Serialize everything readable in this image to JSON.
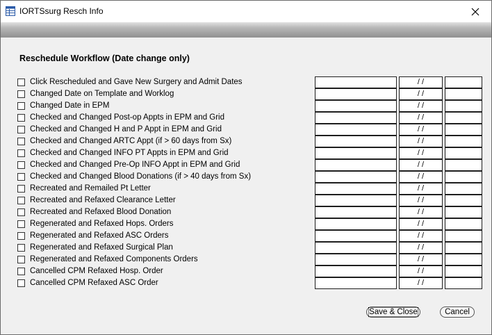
{
  "window": {
    "title": "IORTSsurg Resch Info"
  },
  "section_title": "Reschedule Workflow (Date change only)",
  "date_placeholder": " / /",
  "rows": [
    {
      "label": "Click Rescheduled and Gave New Surgery and Admit Dates",
      "date": " / /"
    },
    {
      "label": "Changed Date on Template and Worklog",
      "date": " / /"
    },
    {
      "label": "Changed Date in EPM",
      "date": " / /"
    },
    {
      "label": "Checked and Changed Post-op Appts in EPM and Grid",
      "date": " / /"
    },
    {
      "label": "Checked and Changed H and P Appt in EPM and Grid",
      "date": " / /"
    },
    {
      "label": "Checked and Changed ARTC Appt (if > 60 days from Sx)",
      "date": " / /"
    },
    {
      "label": "Checked and Changed INFO PT Appts in EPM and Grid",
      "date": " / /"
    },
    {
      "label": "Checked and Changed Pre-Op INFO Appt in EPM and Grid",
      "date": " / /"
    },
    {
      "label": "Checked and Changed Blood Donations (if > 40 days from Sx)",
      "date": " / /"
    },
    {
      "label": "Recreated and Remailed Pt Letter",
      "date": " / /"
    },
    {
      "label": "Recreated and Refaxed Clearance Letter",
      "date": " / /"
    },
    {
      "label": "Recreated and Refaxed Blood Donation",
      "date": " / /"
    },
    {
      "label": "Regenerated and Refaxed Hops. Orders",
      "date": " / /"
    },
    {
      "label": "Regenerated and Refaxed ASC Orders",
      "date": " / /"
    },
    {
      "label": "Regenerated and Refaxed Surgical Plan",
      "date": " / /"
    },
    {
      "label": "Regenerated and Refaxed Components Orders",
      "date": " / /"
    },
    {
      "label": "Cancelled CPM Refaxed Hosp. Order",
      "date": " / /"
    },
    {
      "label": "Cancelled CPM Refaxed ASC Order",
      "date": " / /"
    }
  ],
  "buttons": {
    "save": "Save & Close",
    "cancel": "Cancel"
  },
  "icons": {
    "app": "window-app-icon",
    "close": "close-icon"
  }
}
